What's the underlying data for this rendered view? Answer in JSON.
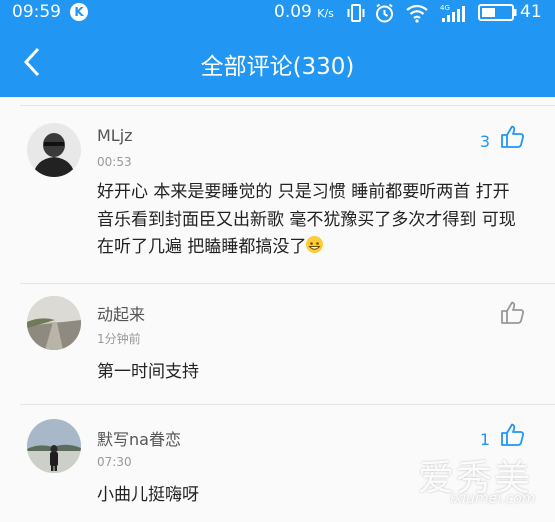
{
  "status_bar": {
    "time": "09:59",
    "app_badge": "K",
    "net_speed": "0.09",
    "net_unit": "K/s",
    "battery": "41"
  },
  "header": {
    "title": "全部评论(330)"
  },
  "comments": [
    {
      "username": "MLjz",
      "time": "00:53",
      "text": "好开心 本来是要睡觉的 只是习惯 睡前都要听两首 打开音乐看到封面臣又出新歌 毫不犹豫买了多次才得到 可现在听了几遍 把瞌睡都搞没了",
      "likes": "3"
    },
    {
      "username": "动起来",
      "time": "1分钟前",
      "text": "第一时间支持",
      "likes": ""
    },
    {
      "username": "默写na眷恋",
      "time": "07:30",
      "text": "小曲儿挺嗨呀",
      "likes": "1"
    }
  ],
  "watermark": {
    "cn": "爱秀美",
    "en": "ixiumei.com"
  },
  "colors": {
    "accent": "#2196f3"
  }
}
